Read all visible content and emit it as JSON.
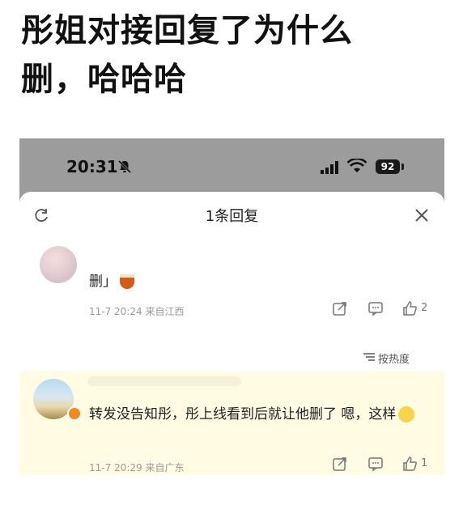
{
  "headline": {
    "line1": "彤姐对接回复了为什么",
    "line2": "删，哈哈哈"
  },
  "status_bar": {
    "time": "20:31",
    "battery": "92"
  },
  "sheet": {
    "title": "1条回复"
  },
  "comments": [
    {
      "text": "删」",
      "date": "11-7 20:24",
      "location": "来自江西",
      "likes": "2"
    },
    {
      "text": "转发没告知彤，彤上线看到后就让他删了 嗯，这样",
      "date": "11-7 20:29",
      "location": "来自广东",
      "likes": "1"
    }
  ],
  "sort_label": "按热度",
  "icons": [
    "bell-mute-icon",
    "signal-icon",
    "wifi-icon",
    "battery-icon",
    "refresh-icon",
    "close-icon",
    "share-icon",
    "comment-icon",
    "like-icon",
    "sort-icon"
  ]
}
